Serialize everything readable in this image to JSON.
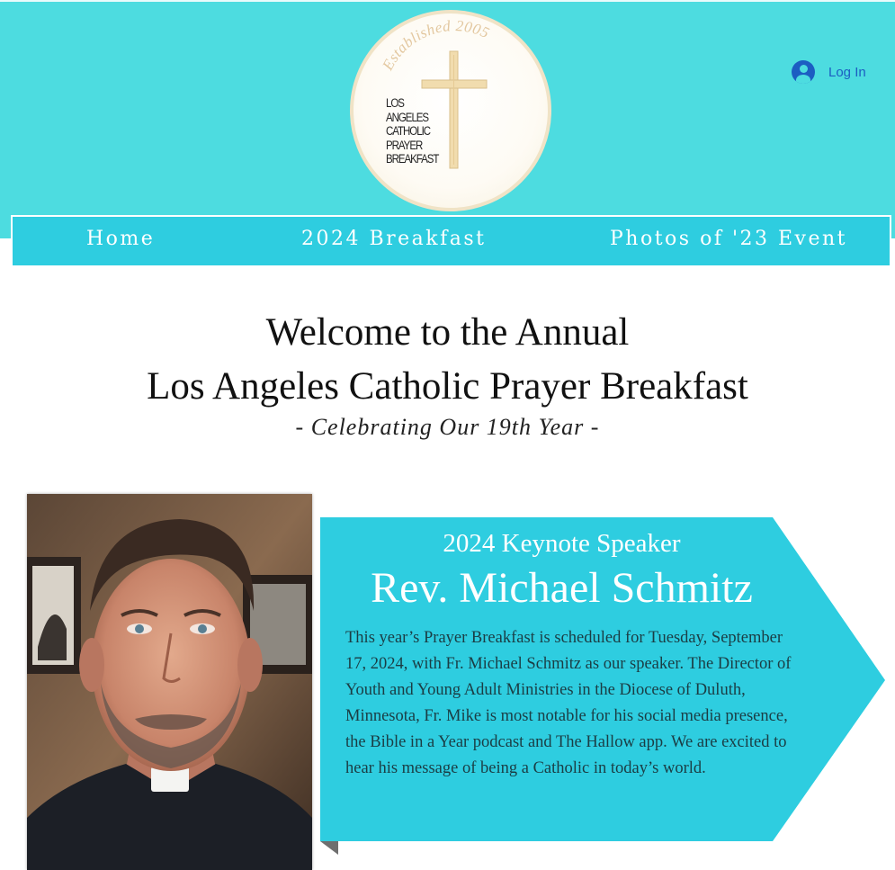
{
  "header": {
    "background": "#4ddce0",
    "logo": {
      "established": "Established 2005",
      "lines": [
        "LOS",
        "ANGELES",
        "CATHOLIC",
        "PRAYER",
        "BREAKFAST"
      ],
      "icon": "cross-icon"
    },
    "login": {
      "label": "Log In",
      "icon": "user-avatar-icon",
      "color": "#1c5ec2"
    }
  },
  "nav": {
    "background": "#2ecde0",
    "items": [
      {
        "label": "Home"
      },
      {
        "label": "2024 Breakfast"
      },
      {
        "label": "Photos of '23 Event"
      }
    ]
  },
  "main": {
    "welcome_line1": "Welcome to the Annual",
    "welcome_line2": "Los Angeles Catholic Prayer Breakfast",
    "tagline": "- Celebrating Our 19th Year -"
  },
  "speaker": {
    "photo_icon": "speaker-portrait",
    "subtitle": "2024 Keynote Speaker",
    "name": "Rev. Michael Schmitz",
    "description": "This year’s Prayer Breakfast is scheduled for Tuesday, September 17, 2024, with Fr. Michael Schmitz as our speaker.  The Director of Youth and Young Adult Ministries in the Diocese of Duluth, Minnesota,  Fr. Mike is most notable for his social media presence, the Bible in a Year podcast and The Hallow app.  We are excited to hear his message of being a Catholic in today’s world.",
    "panel_color": "#2ecde0"
  }
}
